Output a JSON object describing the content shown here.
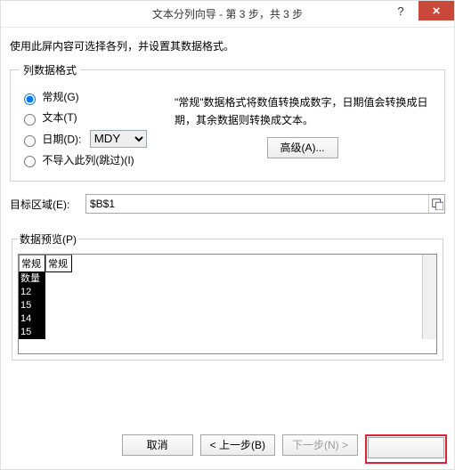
{
  "window": {
    "title": "文本分列向导 - 第 3 步，共 3 步",
    "help_label": "?",
    "close_label": "×"
  },
  "intro": "使用此屏内容可选择各列，并设置其数据格式。",
  "format_group": {
    "legend": "列数据格式",
    "general": "常规(G)",
    "text": "文本(T)",
    "date": "日期(D):",
    "date_option": "MDY",
    "skip": "不导入此列(跳过)(I)"
  },
  "description": "\"常规\"数据格式将数值转换成数字，日期值会转换成日期，其余数据则转换成文本。",
  "advanced_label": "高级(A)...",
  "destination": {
    "label": "目标区域(E):",
    "value": "$B$1"
  },
  "preview": {
    "legend": "数据预览(P)",
    "headers": [
      "常规",
      "常规"
    ],
    "col0": [
      "数量",
      "12",
      "15",
      "14",
      "15"
    ]
  },
  "footer": {
    "cancel": "取消",
    "back": "< 上一步(B)",
    "next": "下一步(N) >",
    "finish": " "
  }
}
